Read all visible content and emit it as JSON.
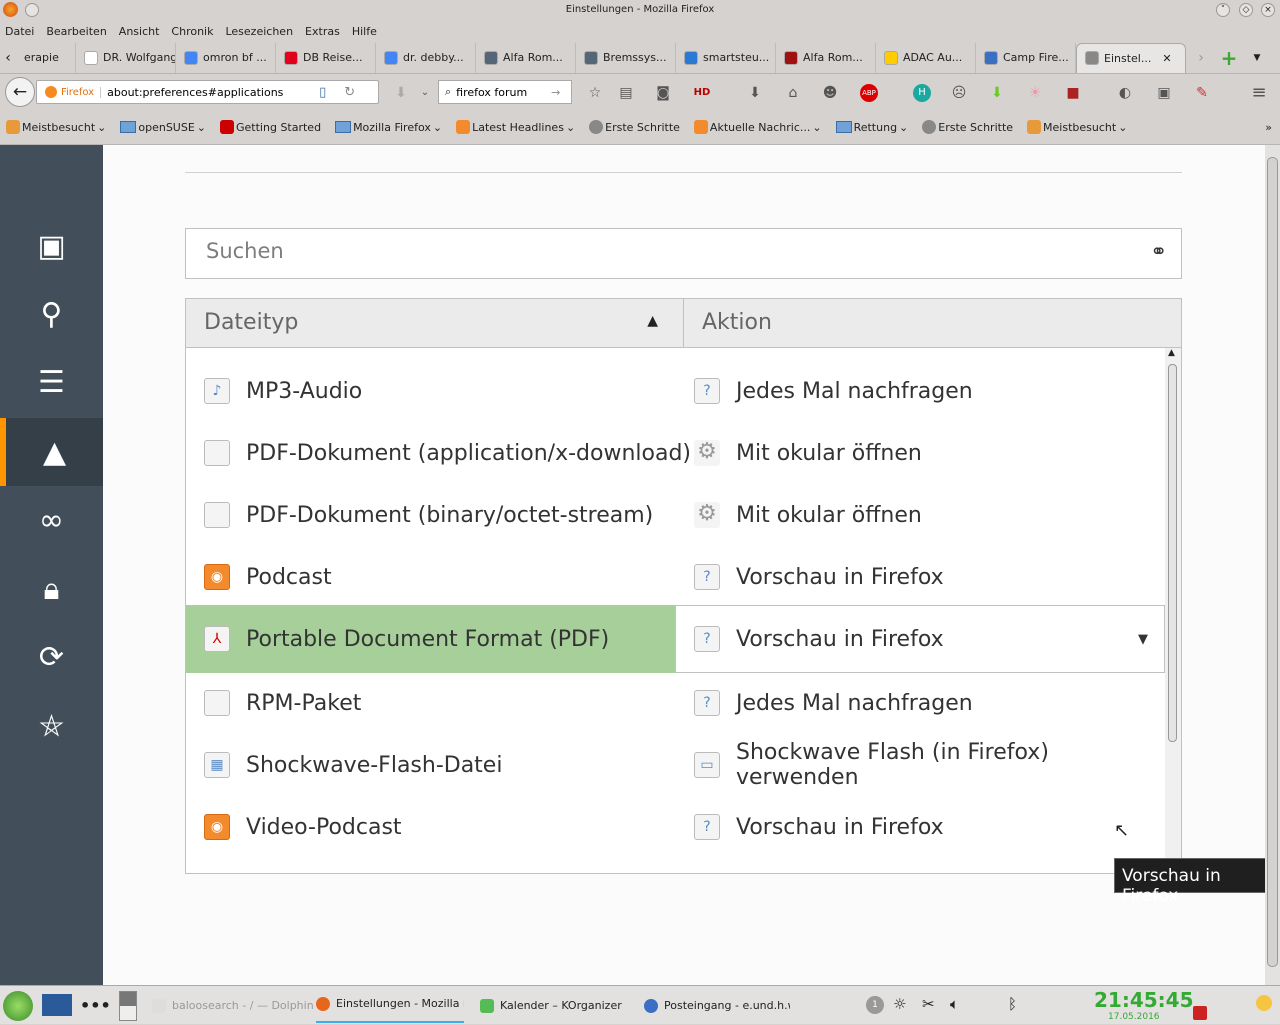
{
  "window": {
    "title": "Einstellungen - Mozilla Firefox"
  },
  "menu": [
    "Datei",
    "Bearbeiten",
    "Ansicht",
    "Chronik",
    "Lesezeichen",
    "Extras",
    "Hilfe"
  ],
  "tabs": [
    {
      "label": "erapie",
      "color": "#ffffff"
    },
    {
      "label": "DR. Wolfgang ...",
      "color": "#ffffff"
    },
    {
      "label": "omron bf ...",
      "color": "#4285f4"
    },
    {
      "label": "DB Reise...",
      "color": "#e2001a"
    },
    {
      "label": "dr. debby...",
      "color": "#4285f4"
    },
    {
      "label": "Alfa Rom...",
      "color": "#556677"
    },
    {
      "label": "Bremssys...",
      "color": "#556677"
    },
    {
      "label": "smartsteu...",
      "color": "#2a7ad5"
    },
    {
      "label": "Alfa Rom...",
      "color": "#a01010"
    },
    {
      "label": "ADAC Au...",
      "color": "#ffcc00"
    },
    {
      "label": "Camp Fire...",
      "color": "#3b6fc4"
    },
    {
      "label": "Einstel...",
      "color": "#888888"
    }
  ],
  "navbar": {
    "identity": "Firefox",
    "url": "about:preferences#applications",
    "search": "firefox forum"
  },
  "bookmarks": [
    "Meistbesucht",
    "openSUSE",
    "Getting Started",
    "Mozilla Firefox",
    "Latest Headlines",
    "Erste Schritte",
    "Aktuelle Nachric...",
    "Rettung",
    "Erste Schritte",
    "Meistbesucht"
  ],
  "search": {
    "placeholder": "Suchen"
  },
  "table": {
    "headers": [
      "Dateityp",
      "Aktion"
    ],
    "rows": [
      {
        "type": "MP3-Audio",
        "action": "Jedes Mal nachfragen",
        "icon": "audio-file-icon",
        "aicon": "question-icon"
      },
      {
        "type": "PDF-Dokument (application/x-download)",
        "action": "Mit okular öffnen",
        "icon": "file-icon",
        "aicon": "gear-icon"
      },
      {
        "type": "PDF-Dokument (binary/octet-stream)",
        "action": "Mit okular öffnen",
        "icon": "file-icon",
        "aicon": "gear-icon"
      },
      {
        "type": "Podcast",
        "action": "Vorschau in Firefox",
        "icon": "rss-icon",
        "aicon": "question-icon"
      },
      {
        "type": "Portable Document Format (PDF)",
        "action": "Vorschau in Firefox",
        "icon": "pdf-icon",
        "aicon": "question-icon",
        "selected": true
      },
      {
        "type": "RPM-Paket",
        "action": "Jedes Mal nachfragen",
        "icon": "file-icon",
        "aicon": "question-icon"
      },
      {
        "type": "Shockwave-Flash-Datei",
        "action": "Shockwave Flash (in Firefox) verwenden",
        "icon": "flash-icon",
        "aicon": "plugin-icon"
      },
      {
        "type": "Video-Podcast",
        "action": "Vorschau in Firefox",
        "icon": "rss-icon",
        "aicon": "question-icon"
      }
    ]
  },
  "tooltip": "Vorschau in Firefox",
  "taskbar": {
    "tasks": [
      "baloosearch - / — Dolphin",
      "Einstellungen - Mozilla Fire",
      "Kalender – KOrganizer",
      "Posteingang - e.und.h.we"
    ],
    "time": "21:45:45",
    "date": "17.05.2016",
    "badge": "1"
  },
  "colors": {
    "sidebar": "#424f5a",
    "accent": "#ff9500",
    "selected_row": "#a7cf9a"
  }
}
